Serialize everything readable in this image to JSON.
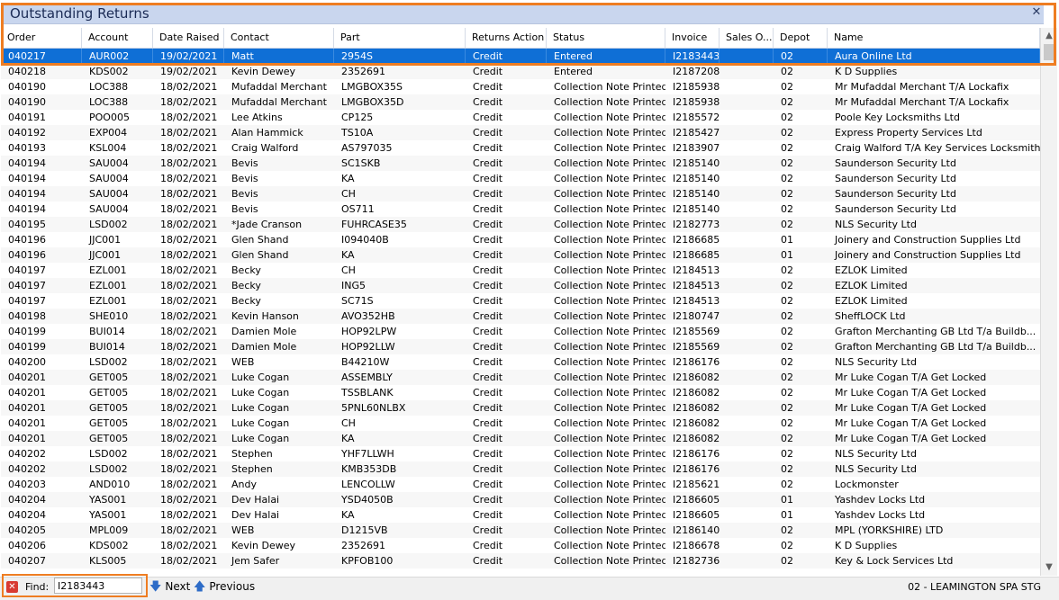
{
  "window": {
    "title": "Outstanding Returns",
    "close_glyph": "✕"
  },
  "columns": [
    {
      "key": "order",
      "label": "Order"
    },
    {
      "key": "account",
      "label": "Account"
    },
    {
      "key": "date_raised",
      "label": "Date Raised"
    },
    {
      "key": "contact",
      "label": "Contact"
    },
    {
      "key": "part",
      "label": "Part"
    },
    {
      "key": "returns_action",
      "label": "Returns Action"
    },
    {
      "key": "status",
      "label": "Status"
    },
    {
      "key": "invoice",
      "label": "Invoice"
    },
    {
      "key": "sales_order",
      "label": "Sales O..."
    },
    {
      "key": "depot",
      "label": "Depot"
    },
    {
      "key": "name",
      "label": "Name"
    }
  ],
  "rows": [
    [
      "040217",
      "AUR002",
      "19/02/2021",
      "Matt",
      "2954S",
      "Credit",
      "Entered",
      "I2183443",
      "",
      "02",
      "Aura Online Ltd"
    ],
    [
      "040218",
      "KDS002",
      "19/02/2021",
      "Kevin Dewey",
      "2352691",
      "Credit",
      "Entered",
      "I2187208",
      "",
      "02",
      "K D Supplies"
    ],
    [
      "040190",
      "LOC388",
      "18/02/2021",
      "Mufaddal Merchant",
      "LMGBOX35S",
      "Credit",
      "Collection Note Printed",
      "I2185938",
      "",
      "02",
      "Mr Mufaddal Merchant T/A Lockafix"
    ],
    [
      "040190",
      "LOC388",
      "18/02/2021",
      "Mufaddal Merchant",
      "LMGBOX35D",
      "Credit",
      "Collection Note Printed",
      "I2185938",
      "",
      "02",
      "Mr Mufaddal Merchant T/A Lockafix"
    ],
    [
      "040191",
      "POO005",
      "18/02/2021",
      "Lee Atkins",
      "CP125",
      "Credit",
      "Collection Note Printed",
      "I2185572",
      "",
      "02",
      "Poole Key Locksmiths Ltd"
    ],
    [
      "040192",
      "EXP004",
      "18/02/2021",
      "Alan Hammick",
      "TS10A",
      "Credit",
      "Collection Note Printed",
      "I2185427",
      "",
      "02",
      "Express Property Services Ltd"
    ],
    [
      "040193",
      "KSL004",
      "18/02/2021",
      "Craig Walford",
      "AS797035",
      "Credit",
      "Collection Note Printed",
      "I2183907",
      "",
      "02",
      "Craig Walford T/A Key Services Locksmith"
    ],
    [
      "040194",
      "SAU004",
      "18/02/2021",
      "Bevis",
      "SC1SKB",
      "Credit",
      "Collection Note Printed",
      "I2185140",
      "",
      "02",
      "Saunderson Security Ltd"
    ],
    [
      "040194",
      "SAU004",
      "18/02/2021",
      "Bevis",
      "KA",
      "Credit",
      "Collection Note Printed",
      "I2185140",
      "",
      "02",
      "Saunderson Security Ltd"
    ],
    [
      "040194",
      "SAU004",
      "18/02/2021",
      "Bevis",
      "CH",
      "Credit",
      "Collection Note Printed",
      "I2185140",
      "",
      "02",
      "Saunderson Security Ltd"
    ],
    [
      "040194",
      "SAU004",
      "18/02/2021",
      "Bevis",
      "OS711",
      "Credit",
      "Collection Note Printed",
      "I2185140",
      "",
      "02",
      "Saunderson Security Ltd"
    ],
    [
      "040195",
      "LSD002",
      "18/02/2021",
      "*Jade Cranson",
      "FUHRCASE35",
      "Credit",
      "Collection Note Printed",
      "I2182773",
      "",
      "02",
      "NLS Security Ltd"
    ],
    [
      "040196",
      "JJC001",
      "18/02/2021",
      "Glen Shand",
      "I094040B",
      "Credit",
      "Collection Note Printed",
      "I2186685",
      "",
      "01",
      "Joinery and Construction Supplies Ltd"
    ],
    [
      "040196",
      "JJC001",
      "18/02/2021",
      "Glen Shand",
      "KA",
      "Credit",
      "Collection Note Printed",
      "I2186685",
      "",
      "01",
      "Joinery and Construction Supplies Ltd"
    ],
    [
      "040197",
      "EZL001",
      "18/02/2021",
      "Becky",
      "CH",
      "Credit",
      "Collection Note Printed",
      "I2184513",
      "",
      "02",
      "EZLOK Limited"
    ],
    [
      "040197",
      "EZL001",
      "18/02/2021",
      "Becky",
      "ING5",
      "Credit",
      "Collection Note Printed",
      "I2184513",
      "",
      "02",
      "EZLOK Limited"
    ],
    [
      "040197",
      "EZL001",
      "18/02/2021",
      "Becky",
      "SC71S",
      "Credit",
      "Collection Note Printed",
      "I2184513",
      "",
      "02",
      "EZLOK Limited"
    ],
    [
      "040198",
      "SHE010",
      "18/02/2021",
      "Kevin Hanson",
      "AVO352HB",
      "Credit",
      "Collection Note Printed",
      "I2180747",
      "",
      "02",
      "SheffLOCK Ltd"
    ],
    [
      "040199",
      "BUI014",
      "18/02/2021",
      "Damien Mole",
      "HOP92LPW",
      "Credit",
      "Collection Note Printed",
      "I2185569",
      "",
      "02",
      "Grafton Merchanting GB Ltd T/a Buildb..."
    ],
    [
      "040199",
      "BUI014",
      "18/02/2021",
      "Damien Mole",
      "HOP92LLW",
      "Credit",
      "Collection Note Printed",
      "I2185569",
      "",
      "02",
      "Grafton Merchanting GB Ltd T/a Buildb..."
    ],
    [
      "040200",
      "LSD002",
      "18/02/2021",
      "WEB",
      "B44210W",
      "Credit",
      "Collection Note Printed",
      "I2186176",
      "",
      "02",
      "NLS Security Ltd"
    ],
    [
      "040201",
      "GET005",
      "18/02/2021",
      "Luke Cogan",
      "ASSEMBLY",
      "Credit",
      "Collection Note Printed",
      "I2186082",
      "",
      "02",
      "Mr Luke Cogan T/A Get Locked"
    ],
    [
      "040201",
      "GET005",
      "18/02/2021",
      "Luke Cogan",
      "TSSBLANK",
      "Credit",
      "Collection Note Printed",
      "I2186082",
      "",
      "02",
      "Mr Luke Cogan T/A Get Locked"
    ],
    [
      "040201",
      "GET005",
      "18/02/2021",
      "Luke Cogan",
      "5PNL60NLBX",
      "Credit",
      "Collection Note Printed",
      "I2186082",
      "",
      "02",
      "Mr Luke Cogan T/A Get Locked"
    ],
    [
      "040201",
      "GET005",
      "18/02/2021",
      "Luke Cogan",
      "CH",
      "Credit",
      "Collection Note Printed",
      "I2186082",
      "",
      "02",
      "Mr Luke Cogan T/A Get Locked"
    ],
    [
      "040201",
      "GET005",
      "18/02/2021",
      "Luke Cogan",
      "KA",
      "Credit",
      "Collection Note Printed",
      "I2186082",
      "",
      "02",
      "Mr Luke Cogan T/A Get Locked"
    ],
    [
      "040202",
      "LSD002",
      "18/02/2021",
      "Stephen",
      "YHF7LLWH",
      "Credit",
      "Collection Note Printed",
      "I2186176",
      "",
      "02",
      "NLS Security Ltd"
    ],
    [
      "040202",
      "LSD002",
      "18/02/2021",
      "Stephen",
      "KMB353DB",
      "Credit",
      "Collection Note Printed",
      "I2186176",
      "",
      "02",
      "NLS Security Ltd"
    ],
    [
      "040203",
      "AND010",
      "18/02/2021",
      "Andy",
      "LENCOLLW",
      "Credit",
      "Collection Note Printed",
      "I2185621",
      "",
      "02",
      "Lockmonster"
    ],
    [
      "040204",
      "YAS001",
      "18/02/2021",
      "Dev Halai",
      "YSD4050B",
      "Credit",
      "Collection Note Printed",
      "I2186605",
      "",
      "01",
      "Yashdev Locks Ltd"
    ],
    [
      "040204",
      "YAS001",
      "18/02/2021",
      "Dev Halai",
      "KA",
      "Credit",
      "Collection Note Printed",
      "I2186605",
      "",
      "01",
      "Yashdev Locks Ltd"
    ],
    [
      "040205",
      "MPL009",
      "18/02/2021",
      "WEB",
      "D1215VB",
      "Credit",
      "Collection Note Printed",
      "I2186140",
      "",
      "02",
      "MPL (YORKSHIRE) LTD"
    ],
    [
      "040206",
      "KDS002",
      "18/02/2021",
      "Kevin Dewey",
      "2352691",
      "Credit",
      "Collection Note Printed",
      "I2186678",
      "",
      "02",
      "K D Supplies"
    ],
    [
      "040207",
      "KLS005",
      "18/02/2021",
      "Jem Safer",
      "KPFOB100",
      "Credit",
      "Collection Note Printed",
      "I2182736",
      "",
      "02",
      "Key & Lock Services Ltd"
    ]
  ],
  "selected_row": 0,
  "footer": {
    "find_label": "Find:",
    "find_value": "I2183443",
    "next_label": "Next",
    "previous_label": "Previous",
    "status_text": "02 - LEAMINGTON SPA   STG"
  }
}
